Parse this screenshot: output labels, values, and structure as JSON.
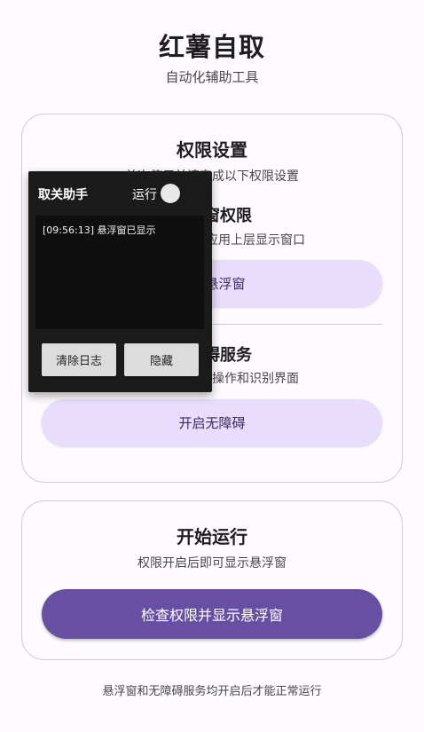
{
  "app": {
    "title": "红薯自取",
    "subtitle": "自动化辅助工具"
  },
  "permissions_card": {
    "title": "权限设置",
    "description": "首次使用前请完成以下权限设置",
    "overlay": {
      "title": "悬浮窗权限",
      "description": "允许应用在其他应用上层显示窗口",
      "button_label": "开启悬浮窗"
    },
    "accessibility": {
      "title": "无障碍服务",
      "description": "用于执行自动化操作和识别界面",
      "button_label": "开启无障碍"
    }
  },
  "run_card": {
    "title": "开始运行",
    "description": "权限开启后即可显示悬浮窗",
    "button_label": "检查权限并显示悬浮窗"
  },
  "footer_note": "悬浮窗和无障碍服务均开启后才能正常运行",
  "floating_window": {
    "title": "取关助手",
    "run_label": "运行",
    "toggle_on": false,
    "log_lines": [
      "[09:56:13] 悬浮窗已显示"
    ],
    "clear_button_label": "清除日志",
    "hide_button_label": "隐藏"
  },
  "colors": {
    "primary": "#6750a4",
    "primary_container": "#e9ddfd",
    "surface": "#fdfbfd",
    "outline": "#cfcbd3",
    "float_bg": "#1b1b1c"
  }
}
